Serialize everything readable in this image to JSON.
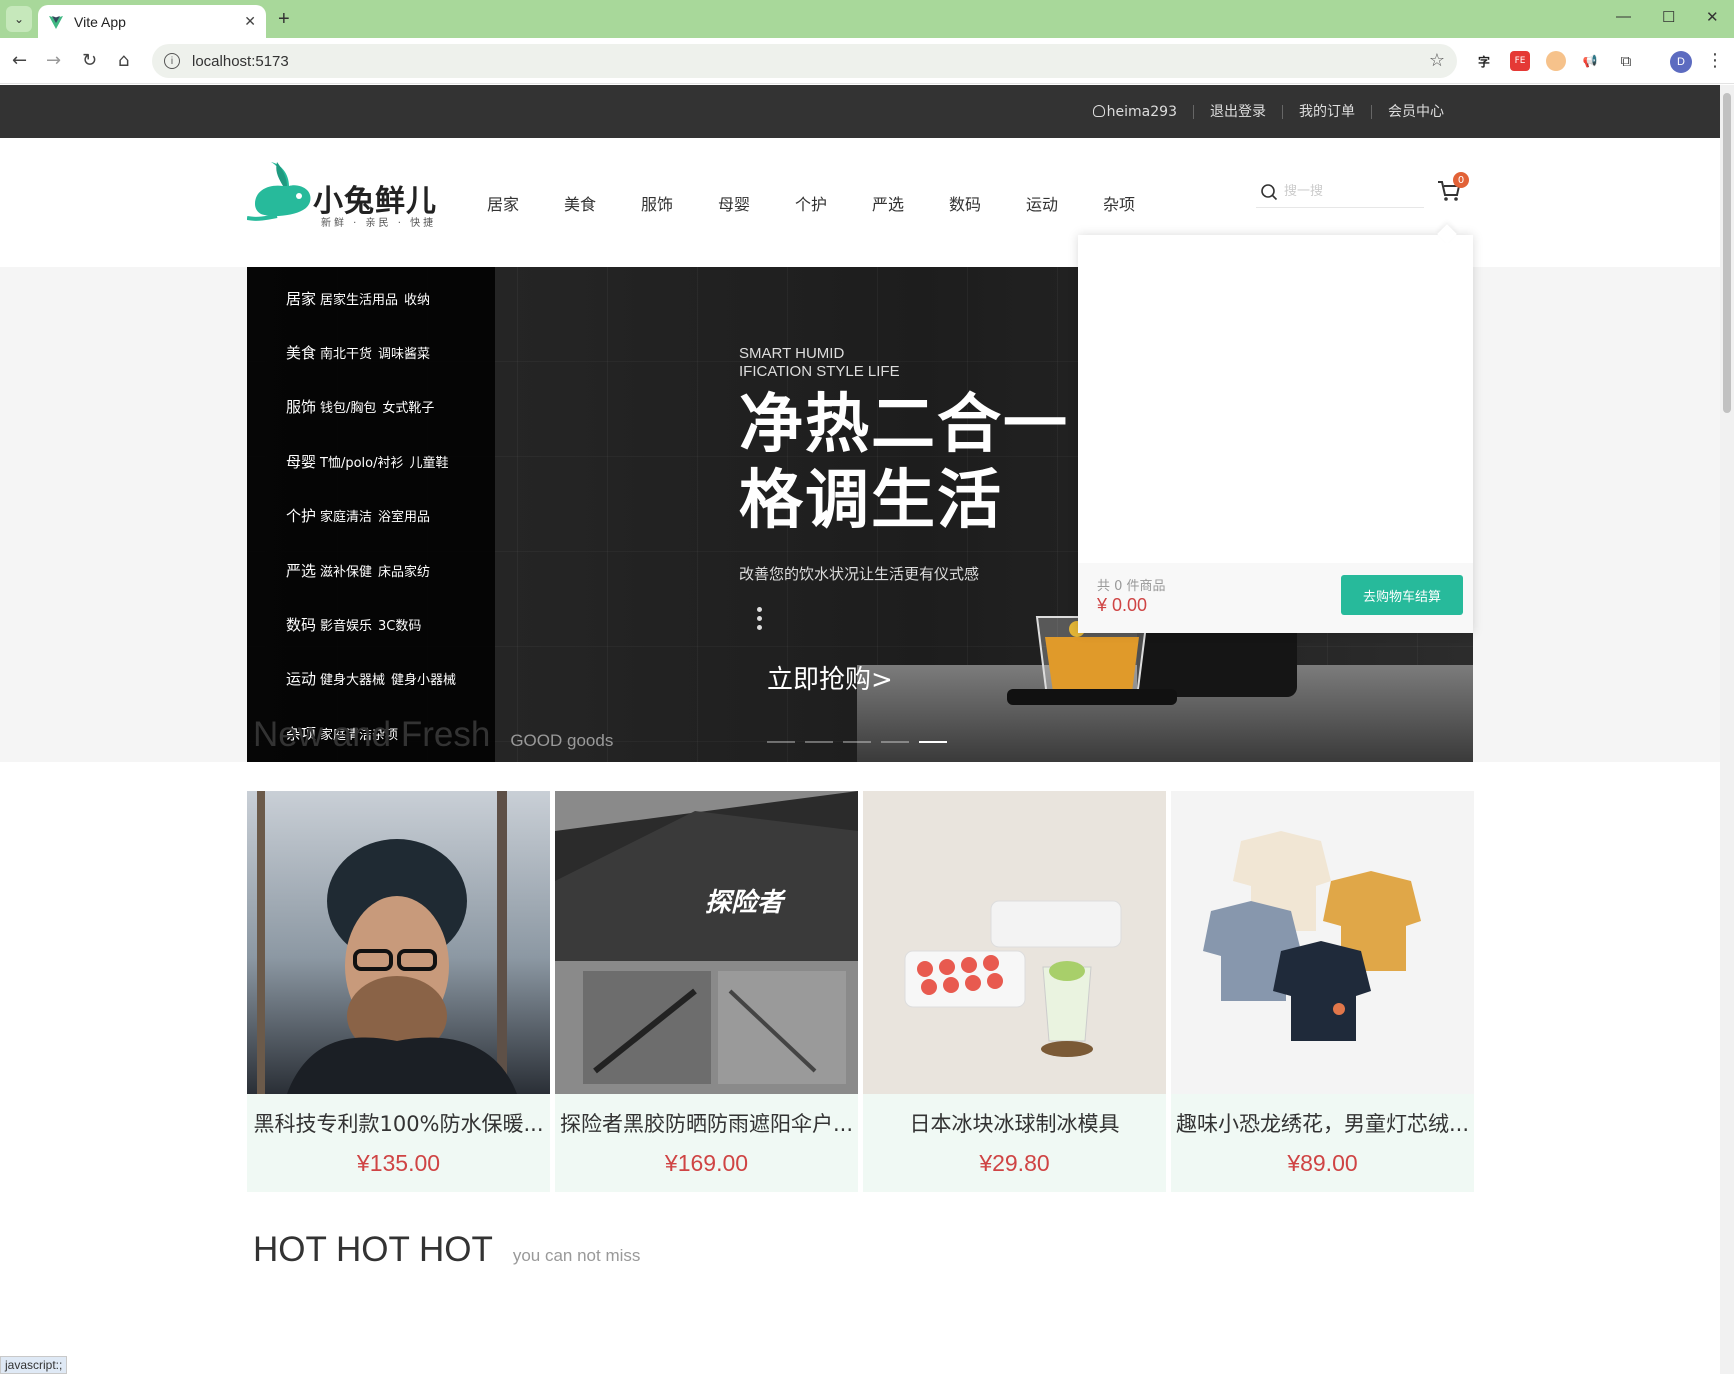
{
  "browser": {
    "tab_title": "Vite App",
    "url": "localhost:5173",
    "profile_initial": "D",
    "status_text": "javascript:;"
  },
  "topnav": {
    "username": "heima293",
    "logout": "退出登录",
    "orders": "我的订单",
    "member": "会员中心"
  },
  "header": {
    "logo_text": "小兔鲜儿",
    "logo_sub": "新鲜 · 亲民 · 快捷",
    "nav": [
      "居家",
      "美食",
      "服饰",
      "母婴",
      "个护",
      "严选",
      "数码",
      "运动",
      "杂项"
    ],
    "search_placeholder": "搜一搜",
    "cart_count": "0"
  },
  "category_menu": [
    {
      "name": "居家",
      "subs": [
        "居家生活用品",
        "收纳"
      ]
    },
    {
      "name": "美食",
      "subs": [
        "南北干货",
        "调味酱菜"
      ]
    },
    {
      "name": "服饰",
      "subs": [
        "钱包/胸包",
        "女式靴子"
      ]
    },
    {
      "name": "母婴",
      "subs": [
        "T恤/polo/衬衫",
        "儿童鞋"
      ]
    },
    {
      "name": "个护",
      "subs": [
        "家庭清洁",
        "浴室用品"
      ]
    },
    {
      "name": "严选",
      "subs": [
        "滋补保健",
        "床品家纺"
      ]
    },
    {
      "name": "数码",
      "subs": [
        "影音娱乐",
        "3C数码"
      ]
    },
    {
      "name": "运动",
      "subs": [
        "健身大器械",
        "健身小器械"
      ]
    },
    {
      "name": "杂项",
      "subs": [
        "家庭清洁杂项"
      ]
    }
  ],
  "banner": {
    "sub_line1": "SMART HUMID",
    "sub_line2": "IFICATION STYLE LIFE",
    "title_line1": "净热二合一",
    "title_line2": "格调生活",
    "desc": "改善您的饮水状况让生活更有仪式感",
    "cta": "立即抢购>",
    "slides": 5,
    "active_slide": 5
  },
  "cart_popup": {
    "count_text": "共 0 件商品",
    "total": "¥ 0.00",
    "checkout": "去购物车结算"
  },
  "new_section": {
    "title": "New and Fresh",
    "subtitle": "GOOD goods",
    "items": [
      {
        "name": "黑科技专利款100%防水保暖...",
        "price": "¥135.00"
      },
      {
        "name": "探险者黑胶防晒防雨遮阳伞户...",
        "price": "¥169.00"
      },
      {
        "name": "日本冰块冰球制冰模具",
        "price": "¥29.80"
      },
      {
        "name": "趣味小恐龙绣花，男童灯芯绒...",
        "price": "¥89.00"
      }
    ]
  },
  "hot_section": {
    "title": "HOT HOT HOT",
    "subtitle": "you can not miss"
  }
}
